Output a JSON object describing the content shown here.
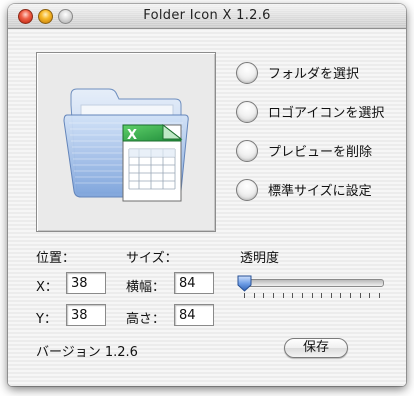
{
  "window": {
    "title": "Folder Icon X 1.2.6"
  },
  "actions": {
    "select_folder": "フォルダを選択",
    "select_logo": "ロゴアイコンを選択",
    "delete_preview": "プレビューを削除",
    "set_default_size": "標準サイズに設定"
  },
  "position": {
    "label": "位置：",
    "x_label": "X：",
    "x_value": "38",
    "y_label": "Y：",
    "y_value": "38"
  },
  "size": {
    "label": "サイズ：",
    "width_label": "横幅：",
    "width_value": "84",
    "height_label": "高さ：",
    "height_value": "84"
  },
  "opacity": {
    "label": "透明度",
    "value_fraction": 0.0
  },
  "footer": {
    "version": "バージョン 1.2.6",
    "save_label": "保存"
  },
  "colors": {
    "slider_thumb": "#4a7fd0",
    "folder": "#8fb4e6",
    "logo_green": "#2fa84a"
  },
  "icons": [
    "close-button",
    "minimize-button",
    "zoom-button",
    "folder-icon",
    "spreadsheet-logo-icon"
  ]
}
